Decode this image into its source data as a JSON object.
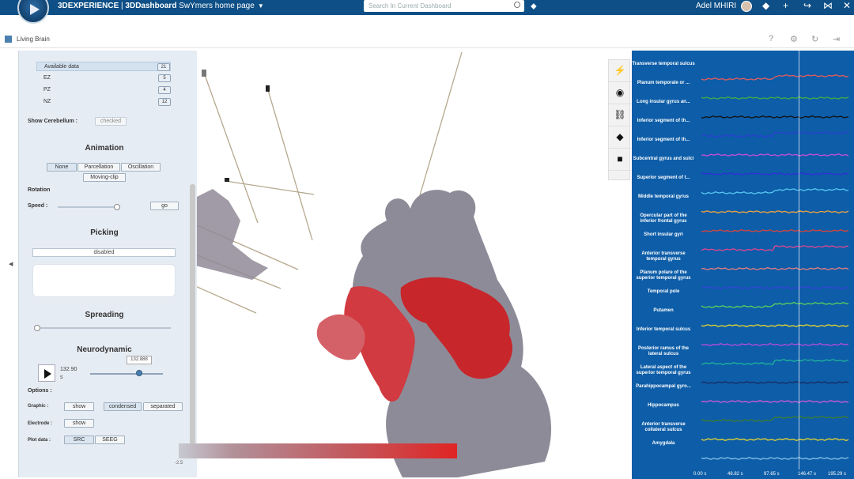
{
  "topbar": {
    "brand": "3DEXPERIENCE",
    "app": "3DDashboard",
    "dashboard": "SwYmers home page",
    "search_placeholder": "Search In Current Dashboard",
    "user": "Adel MHIRI"
  },
  "widget": {
    "title": "Living Brain"
  },
  "left_panel": {
    "data_rows": [
      {
        "label": "Available data",
        "count": "21"
      },
      {
        "label": "EZ",
        "count": "5"
      },
      {
        "label": "PZ",
        "count": "4"
      },
      {
        "label": "NZ",
        "count": "12"
      }
    ],
    "show_cerebellum_label": "Show Cerebellum :",
    "show_cerebellum_value": "checked",
    "animation_title": "Animation",
    "animation_buttons": [
      "None",
      "Parcellation",
      "Oscillation",
      "Moving-clip"
    ],
    "rotation_title": "Rotation",
    "speed_label": "Speed :",
    "go_label": "go",
    "picking_title": "Picking",
    "picking_value": "disabled",
    "spreading_title": "Spreading",
    "neurodynamic_title": "Neurodynamic",
    "time_value": "132.90",
    "time_unit": "s",
    "time_tooltip": "132.888",
    "options_title": "Options :",
    "graphic_label": "Graphic :",
    "graphic_buttons": [
      "show",
      "condensed",
      "separated"
    ],
    "electrode_label": "Electrode :",
    "electrode_button": "show",
    "plot_data_label": "Plot data :",
    "plot_buttons": [
      "SRC",
      "SEEG"
    ],
    "colorbar_min": "-2.5"
  },
  "signals": {
    "labels": [
      "Transverse temporal sulcus",
      "Planum temporale or ...",
      "Long insular gyrus an...",
      "Inferior segment of th...",
      "Inferior segment of th...",
      "Subcentral gyrus and sulci",
      "Superior segment of t...",
      "Middle temporal gyrus",
      "Opercular part of the inferior frontal gyrus",
      "Short insular gyri",
      "Anterior transverse temporal gyrus",
      "Planum polare of the superior temporal gyrus",
      "Temporal pole",
      "Putamen",
      "Inferior temporal sulcus",
      "Posterior ramus of the lateral sulcus",
      "Lateral aspect of the superior temporal gyrus",
      "Parahippocampal gyro...",
      "Hippocampus",
      "Anterior transverse collateral sulcus",
      "Amygdala"
    ],
    "colors": [
      "#e45c5c",
      "#3fae45",
      "#111111",
      "#2b3fd1",
      "#c94fd6",
      "#2f2fd6",
      "#59c9f2",
      "#f2a340",
      "#d8463e",
      "#e0468f",
      "#e87e7e",
      "#3546d8",
      "#5ad45a",
      "#e6d630",
      "#b94ce0",
      "#1fb59a",
      "#1a2a60",
      "#d35ad6",
      "#3f7d2e",
      "#e6d630",
      "#86c3e6",
      "#5ac9f0"
    ],
    "xticks": [
      "0.00 s",
      "48.82 s",
      "97.65 s",
      "146.47 s",
      "195.29 s"
    ]
  }
}
